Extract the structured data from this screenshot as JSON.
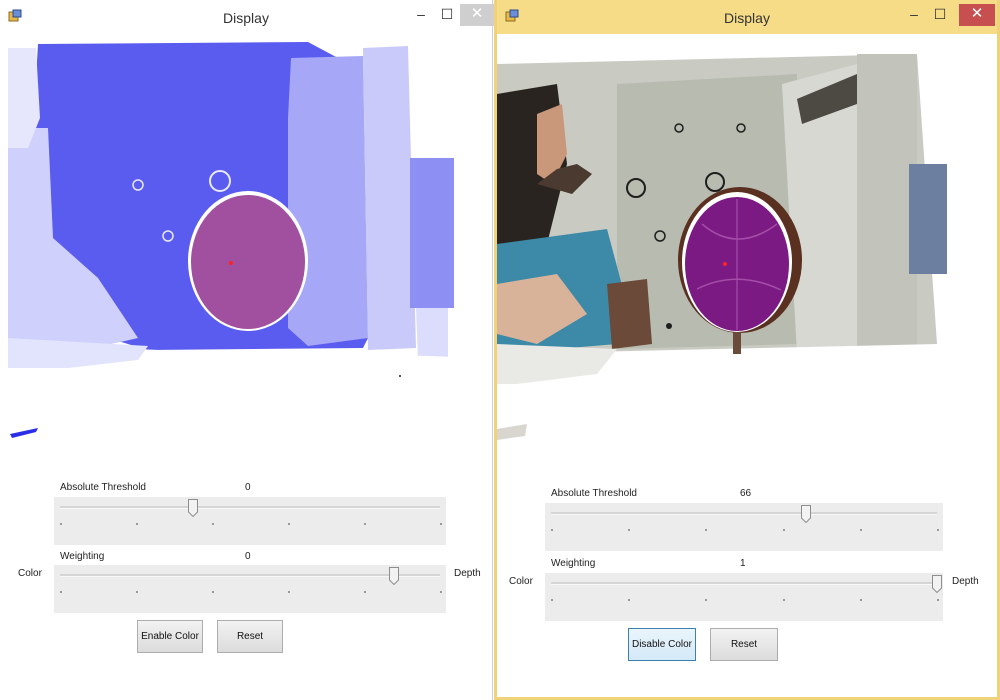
{
  "left_window": {
    "title": "Display",
    "controls": {
      "minimize": "–",
      "maximize": "☐",
      "close": "✕"
    },
    "threshold": {
      "label": "Absolute Threshold",
      "value": "0",
      "level": 0.35
    },
    "weighting": {
      "label": "Weighting",
      "value": "0",
      "level": 0.88
    },
    "scale": {
      "left": "Color",
      "right": "Depth"
    },
    "buttons": {
      "toggle_color": "Enable Color",
      "reset": "Reset"
    },
    "view": "depth map with detected ball"
  },
  "right_window": {
    "title": "Display",
    "controls": {
      "minimize": "–",
      "maximize": "☐",
      "close": "✕"
    },
    "threshold": {
      "label": "Absolute Threshold",
      "value": "66",
      "level": 0.66
    },
    "weighting": {
      "label": "Weighting",
      "value": "1",
      "level": 1.0
    },
    "scale": {
      "left": "Color",
      "right": "Depth"
    },
    "buttons": {
      "toggle_color": "Disable Color",
      "reset": "Reset"
    },
    "view": "color camera image with detected ball"
  },
  "colors": {
    "depth_blue": "#5a5cf0",
    "ball_purple": "#a0509f",
    "ball_dark": "#7c1a83",
    "marker": "#ff2222",
    "titlebar_active": "#f6dc86",
    "close_red": "#c74f4f"
  }
}
